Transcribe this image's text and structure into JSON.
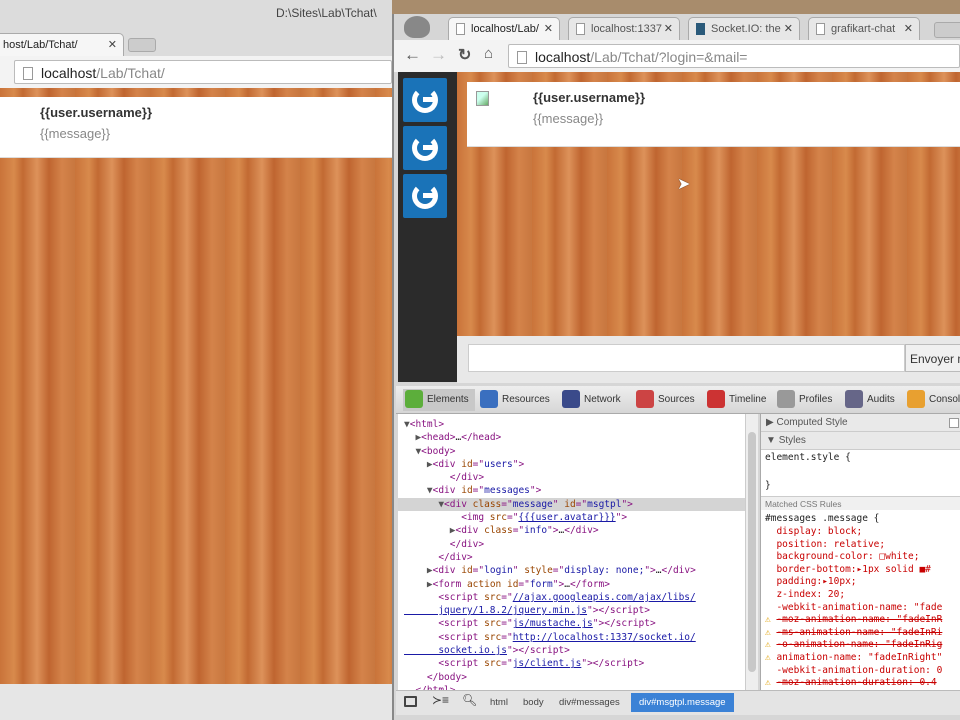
{
  "left_window": {
    "title": "D:\\Sites\\Lab\\Tchat\\",
    "tab_label": "host/Lab/Tchat/",
    "url_host": "localhost",
    "url_path": "/Lab/Tchat/",
    "message": {
      "username": "{{user.username}}",
      "text": "{{message}}"
    }
  },
  "right_window": {
    "tabs": [
      {
        "label": "localhost/Lab/",
        "active": true
      },
      {
        "label": "localhost:1337",
        "active": false
      },
      {
        "label": "Socket.IO: the",
        "active": false
      },
      {
        "label": "grafikart-chat",
        "active": false
      }
    ],
    "url_host": "localhost",
    "url_path": "/Lab/Tchat/?login=&mail=",
    "message": {
      "username": "{{user.username}}",
      "text": "{{message}}"
    },
    "input_value": "",
    "send_button": "Envoyer m"
  },
  "devtools": {
    "tabs": [
      {
        "label": "Elements",
        "color": "#5cae3b"
      },
      {
        "label": "Resources",
        "color": "#3a6fbf"
      },
      {
        "label": "Network",
        "color": "#3a4a8a"
      },
      {
        "label": "Sources",
        "color": "#c44"
      },
      {
        "label": "Timeline",
        "color": "#c33"
      },
      {
        "label": "Profiles",
        "color": "#999"
      },
      {
        "label": "Audits",
        "color": "#668"
      },
      {
        "label": "Console",
        "color": "#e8a030"
      }
    ],
    "dom_lines": [
      [
        {
          "c": "arrow",
          "t": "▼"
        },
        {
          "c": "tag",
          "t": "<html>"
        }
      ],
      [
        {
          "c": "arrow",
          "t": "  ▶"
        },
        {
          "c": "tag",
          "t": "<head>"
        },
        {
          "c": "txt",
          "t": "…"
        },
        {
          "c": "tag",
          "t": "</head>"
        }
      ],
      [
        {
          "c": "arrow",
          "t": "  ▼"
        },
        {
          "c": "tag",
          "t": "<body>"
        }
      ],
      [
        {
          "c": "arrow",
          "t": "    ▶"
        },
        {
          "c": "tag",
          "t": "<div "
        },
        {
          "c": "attr",
          "t": "id"
        },
        {
          "c": "tag",
          "t": "=\""
        },
        {
          "c": "val",
          "t": "users"
        },
        {
          "c": "tag",
          "t": "\">"
        }
      ],
      [
        {
          "c": "tag",
          "t": "        </div>"
        }
      ],
      [
        {
          "c": "arrow",
          "t": "    ▼"
        },
        {
          "c": "tag",
          "t": "<div "
        },
        {
          "c": "attr",
          "t": "id"
        },
        {
          "c": "tag",
          "t": "=\""
        },
        {
          "c": "val",
          "t": "messages"
        },
        {
          "c": "tag",
          "t": "\">"
        }
      ],
      [
        {
          "c": "arrow",
          "t": "      ▼"
        },
        {
          "c": "tag",
          "t": "<div "
        },
        {
          "c": "attr",
          "t": "class"
        },
        {
          "c": "tag",
          "t": "=\""
        },
        {
          "c": "val",
          "t": "message"
        },
        {
          "c": "tag",
          "t": "\" "
        },
        {
          "c": "attr",
          "t": "id"
        },
        {
          "c": "tag",
          "t": "=\""
        },
        {
          "c": "val",
          "t": "msgtpl"
        },
        {
          "c": "tag",
          "t": "\">"
        }
      ],
      [
        {
          "c": "tag",
          "t": "          <img "
        },
        {
          "c": "attr",
          "t": "src"
        },
        {
          "c": "tag",
          "t": "=\""
        },
        {
          "c": "link",
          "t": "{{{user.avatar}}}"
        },
        {
          "c": "tag",
          "t": "\">"
        }
      ],
      [
        {
          "c": "arrow",
          "t": "        ▶"
        },
        {
          "c": "tag",
          "t": "<div "
        },
        {
          "c": "attr",
          "t": "class"
        },
        {
          "c": "tag",
          "t": "=\""
        },
        {
          "c": "val",
          "t": "info"
        },
        {
          "c": "tag",
          "t": "\">"
        },
        {
          "c": "txt",
          "t": "…"
        },
        {
          "c": "tag",
          "t": "</div>"
        }
      ],
      [
        {
          "c": "tag",
          "t": "        </div>"
        }
      ],
      [
        {
          "c": "tag",
          "t": "      </div>"
        }
      ],
      [
        {
          "c": "arrow",
          "t": "    ▶"
        },
        {
          "c": "tag",
          "t": "<div "
        },
        {
          "c": "attr",
          "t": "id"
        },
        {
          "c": "tag",
          "t": "=\""
        },
        {
          "c": "val",
          "t": "login"
        },
        {
          "c": "tag",
          "t": "\" "
        },
        {
          "c": "attr",
          "t": "style"
        },
        {
          "c": "tag",
          "t": "=\""
        },
        {
          "c": "val",
          "t": "display: none;"
        },
        {
          "c": "tag",
          "t": "\">"
        },
        {
          "c": "txt",
          "t": "…"
        },
        {
          "c": "tag",
          "t": "</div>"
        }
      ],
      [
        {
          "c": "arrow",
          "t": "    ▶"
        },
        {
          "c": "tag",
          "t": "<form "
        },
        {
          "c": "attr",
          "t": "action id"
        },
        {
          "c": "tag",
          "t": "=\""
        },
        {
          "c": "val",
          "t": "form"
        },
        {
          "c": "tag",
          "t": "\">"
        },
        {
          "c": "txt",
          "t": "…"
        },
        {
          "c": "tag",
          "t": "</form>"
        }
      ],
      [
        {
          "c": "tag",
          "t": "      <script "
        },
        {
          "c": "attr",
          "t": "src"
        },
        {
          "c": "tag",
          "t": "=\""
        },
        {
          "c": "link",
          "t": "//ajax.googleapis.com/ajax/libs/"
        }
      ],
      [
        {
          "c": "link",
          "t": "      jquery/1.8.2/jquery.min.js"
        },
        {
          "c": "tag",
          "t": "\"></script>"
        }
      ],
      [
        {
          "c": "tag",
          "t": "      <script "
        },
        {
          "c": "attr",
          "t": "src"
        },
        {
          "c": "tag",
          "t": "=\""
        },
        {
          "c": "link",
          "t": "js/mustache.js"
        },
        {
          "c": "tag",
          "t": "\"></script>"
        }
      ],
      [
        {
          "c": "tag",
          "t": "      <script "
        },
        {
          "c": "attr",
          "t": "src"
        },
        {
          "c": "tag",
          "t": "=\""
        },
        {
          "c": "link",
          "t": "http://localhost:1337/socket.io/"
        }
      ],
      [
        {
          "c": "link",
          "t": "      socket.io.js"
        },
        {
          "c": "tag",
          "t": "\"></script>"
        }
      ],
      [
        {
          "c": "tag",
          "t": "      <script "
        },
        {
          "c": "attr",
          "t": "src"
        },
        {
          "c": "tag",
          "t": "=\""
        },
        {
          "c": "link",
          "t": "js/client.js"
        },
        {
          "c": "tag",
          "t": "\"></script>"
        }
      ],
      [
        {
          "c": "tag",
          "t": "    </body>"
        }
      ],
      [
        {
          "c": "tag",
          "t": "  </html>"
        }
      ]
    ],
    "selected_line": 6,
    "styles": {
      "computed_header": "Computed Style",
      "styles_header": "Styles",
      "element_style_open": "element.style {",
      "element_style_close": "}",
      "matched_header": "Matched CSS Rules",
      "selector": "#messages .message {",
      "props": [
        {
          "t": "display: block;",
          "k": "normal"
        },
        {
          "t": "position: relative;",
          "k": "normal"
        },
        {
          "t": "background-color: □white;",
          "k": "normal"
        },
        {
          "t": "border-bottom:▸1px solid ■#",
          "k": "normal"
        },
        {
          "t": "padding:▸10px;",
          "k": "normal"
        },
        {
          "t": "z-index: 20;",
          "k": "normal"
        },
        {
          "t": "-webkit-animation-name: \"fade",
          "k": "normal"
        },
        {
          "t": "-moz-animation-name: \"fadeInR",
          "k": "strike"
        },
        {
          "t": "-ms-animation-name: \"fadeInRi",
          "k": "strike"
        },
        {
          "t": "-o-animation-name: \"fadeInRig",
          "k": "strike"
        },
        {
          "t": "animation-name: \"fadeInRight\"",
          "k": "warn"
        },
        {
          "t": "-webkit-animation-duration: 0",
          "k": "normal"
        },
        {
          "t": "-moz-animation-duration: 0.4",
          "k": "strike"
        }
      ]
    },
    "breadcrumbs": [
      "html",
      "body",
      "div#messages",
      "div#msgtpl.message"
    ]
  }
}
